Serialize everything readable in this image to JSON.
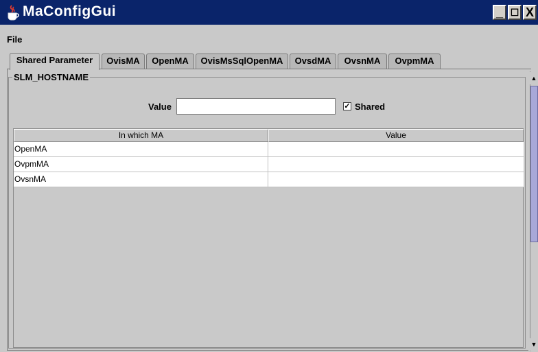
{
  "window": {
    "title": "MaConfigGui",
    "controls": {
      "minimize": "_",
      "maximize": "☐",
      "close": "X"
    },
    "title_bar_color": "#0a246a"
  },
  "menubar": {
    "items": [
      {
        "label": "File"
      }
    ]
  },
  "tabs": [
    {
      "label": "Shared Parameter",
      "active": true
    },
    {
      "label": "OvisMA",
      "active": false
    },
    {
      "label": "OpenMA",
      "active": false
    },
    {
      "label": "OvisMsSqlOpenMA",
      "active": false
    },
    {
      "label": "OvsdMA",
      "active": false
    },
    {
      "label": "OvsnMA",
      "active": false
    },
    {
      "label": "OvpmMA",
      "active": false
    }
  ],
  "panel": {
    "group_title": "SLM_HOSTNAME",
    "value_label": "Value",
    "value_input": "",
    "shared_checked": true,
    "shared_label": "Shared",
    "shared_mark": "✓"
  },
  "table": {
    "headers": [
      "In which MA",
      "Value"
    ],
    "rows": [
      [
        "OpenMA",
        ""
      ],
      [
        "OvpmMA",
        ""
      ],
      [
        "OvsnMA",
        ""
      ]
    ]
  },
  "scrollbar": {
    "up_arrow": "▲",
    "down_arrow": "▼"
  }
}
